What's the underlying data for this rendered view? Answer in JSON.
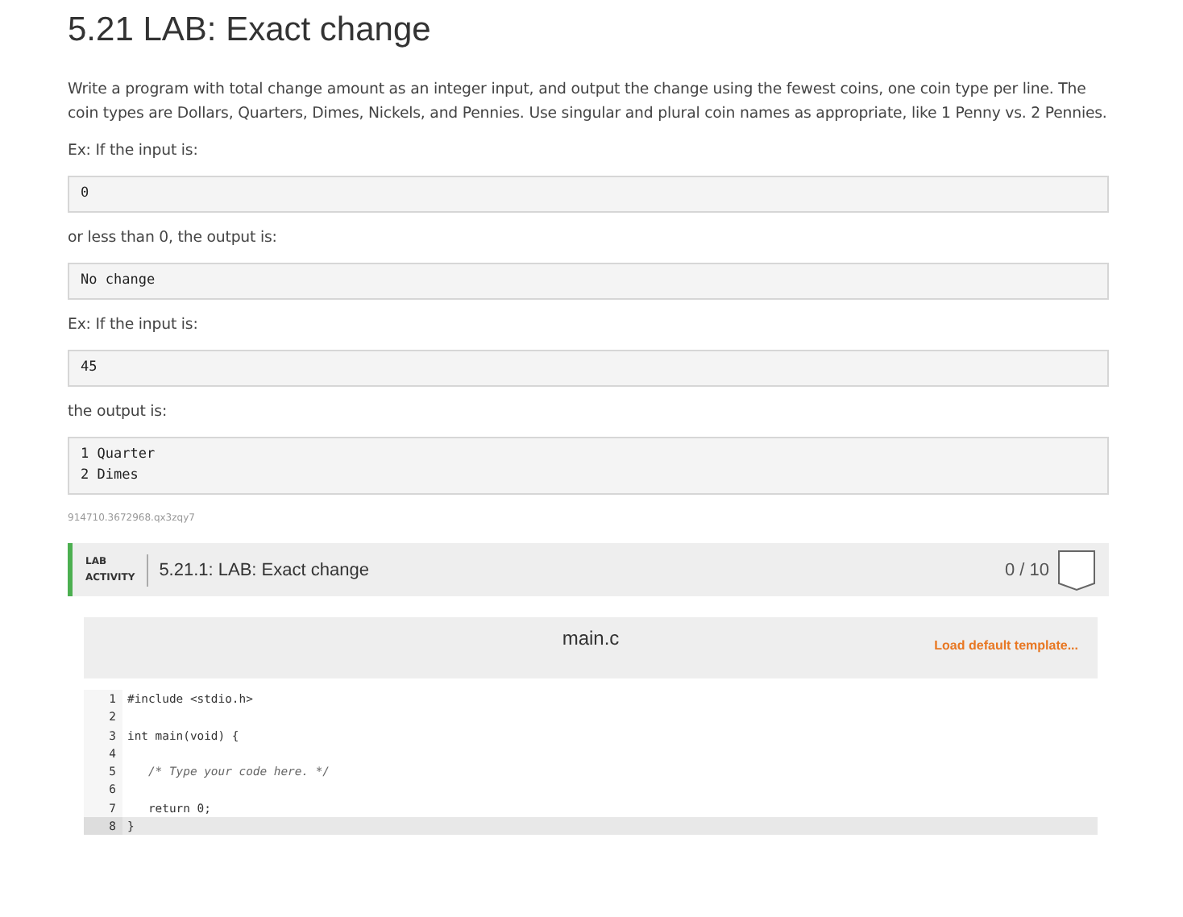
{
  "title": "5.21 LAB: Exact change",
  "description": "Write a program with total change amount as an integer input, and output the change using the fewest coins, one coin type per line. The coin types are Dollars, Quarters, Dimes, Nickels, and Pennies. Use singular and plural coin names as appropriate, like 1 Penny vs. 2 Pennies.",
  "blocks": [
    {
      "kind": "text",
      "text": "Ex: If the input is:"
    },
    {
      "kind": "code",
      "lines": [
        "0"
      ]
    },
    {
      "kind": "text",
      "text": "or less than 0, the output is:"
    },
    {
      "kind": "code",
      "lines": [
        "No change"
      ]
    },
    {
      "kind": "text",
      "text": "Ex: If the input is:"
    },
    {
      "kind": "code",
      "lines": [
        "45"
      ]
    },
    {
      "kind": "text",
      "text": "the output is:"
    },
    {
      "kind": "code",
      "lines": [
        "1 Quarter",
        "2 Dimes"
      ]
    }
  ],
  "id_text": "914710.3672968.qx3zqy7",
  "lab": {
    "badge": [
      "LAB",
      "ACTIVITY"
    ],
    "title": "5.21.1: LAB: Exact change",
    "score": "0 / 10",
    "editor": {
      "filename": "main.c",
      "template_link": "Load default template...",
      "lines": [
        {
          "number": "1",
          "text": "#include <stdio.h>",
          "kind": "code",
          "active": false
        },
        {
          "number": "2",
          "active": false
        },
        {
          "number": "3",
          "text": "int main(void) {",
          "kind": "code",
          "active": false
        },
        {
          "number": "4",
          "active": false
        },
        {
          "number": "5",
          "text": "   /* Type your code here. */",
          "kind": "comment",
          "active": false
        },
        {
          "number": "6",
          "active": false
        },
        {
          "number": "7",
          "text": "   return 0;",
          "kind": "code",
          "active": false
        },
        {
          "number": "8",
          "text": "}",
          "kind": "code",
          "active": true
        }
      ]
    }
  }
}
